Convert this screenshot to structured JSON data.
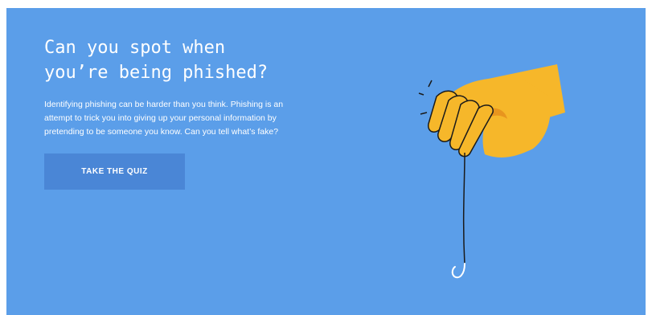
{
  "hero": {
    "title_line1": "Can you spot when",
    "title_line2": "you’re being phished?",
    "description": "Identifying phishing can be harder than you think. Phishing is an attempt to trick you into giving up your personal information by pretending to be someone you know. Can you tell what’s fake?",
    "cta_label": "TAKE THE QUIZ",
    "illustration_icon": "hand-holding-fishhook-icon"
  },
  "colors": {
    "background": "#5b9ee9",
    "button": "#4a86d6",
    "hand": "#f6b72a",
    "hand_shadow": "#e8951e",
    "text": "#ffffff"
  }
}
